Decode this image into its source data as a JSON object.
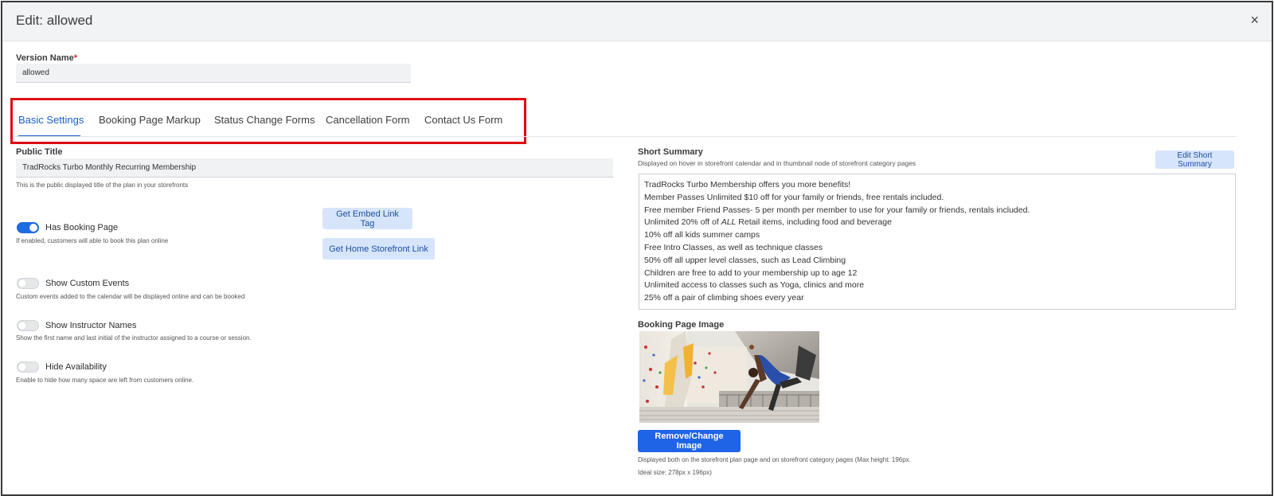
{
  "header": {
    "title": "Edit: allowed",
    "close_icon": "×"
  },
  "version": {
    "label": "Version Name",
    "required_mark": "*",
    "value": "allowed"
  },
  "tabs": [
    {
      "label": "Basic Settings",
      "active": true
    },
    {
      "label": "Booking Page Markup",
      "active": false
    },
    {
      "label": "Status Change Forms",
      "active": false
    },
    {
      "label": "Cancellation Form",
      "active": false
    },
    {
      "label": "Contact Us Form",
      "active": false
    }
  ],
  "public_title": {
    "label": "Public Title",
    "value": "TradRocks Turbo Monthly Recurring Membership",
    "help": "This is the public displayed title of the plan in your storefronts"
  },
  "toggles": [
    {
      "label": "Has Booking Page",
      "help": "If enabled, customers will able to book this plan online",
      "on": true
    },
    {
      "label": "Show Custom Events",
      "help": "Custom events added to the calendar will be displayed online and can be booked",
      "on": false
    },
    {
      "label": "Show Instructor Names",
      "help": "Show the first name and last initial of the instructor assigned to a course or session.",
      "on": false
    },
    {
      "label": "Hide Availability",
      "help": "Enable to hide how many space are left from customers online.",
      "on": false
    }
  ],
  "buttons": {
    "embed_link": "Get Embed Link Tag",
    "storefront_link": "Get Home Storefront Link",
    "edit_summary": "Edit Short Summary",
    "remove_image": "Remove/Change Image"
  },
  "short_summary": {
    "label": "Short Summary",
    "help": "Displayed on hover in storefront calendar and in thumbnail node of storefront category pages",
    "lines": [
      "TradRocks Turbo Membership offers you more benefits!",
      "Member Passes Unlimited $10 off for your family or friends, free rentals included.",
      "Free member Friend Passes- 5 per month per member to use for your family or friends, rentals included.",
      "Unlimited 20% off of ALL Retail items, including food and beverage",
      "10% off all kids summer camps",
      "Free Intro Classes, as well as technique classes",
      "50% off all upper level classes, such as Lead Climbing",
      "Children are free to add to your membership up to age 12",
      "Unlimited access to classes such as Yoga, clinics and more",
      "25% off a pair of climbing shoes every year"
    ]
  },
  "booking_image": {
    "label": "Booking Page Image",
    "help1": "Displayed both on the storefront plan page and on storefront category pages (Max height: 196px.",
    "help2": "Ideal size: 278px x 196px)"
  }
}
